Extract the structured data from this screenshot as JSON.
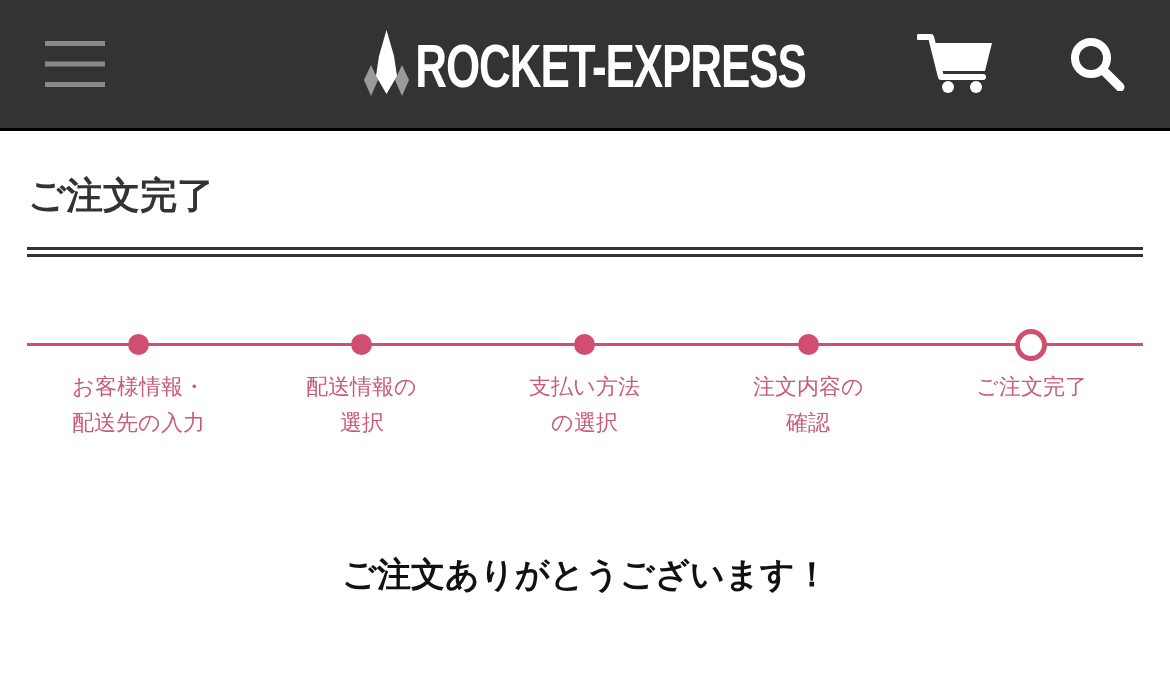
{
  "header": {
    "logo": "ROCKET-EXPRESS"
  },
  "page_title": "ご注文完了",
  "steps": [
    {
      "lines": [
        "お客様情報・",
        "配送先の入力"
      ],
      "current": false
    },
    {
      "lines": [
        "配送情報の",
        "選択"
      ],
      "current": false
    },
    {
      "lines": [
        "支払い方法",
        "の選択"
      ],
      "current": false
    },
    {
      "lines": [
        "注文内容の",
        "確認"
      ],
      "current": false
    },
    {
      "lines": [
        "ご注文完了"
      ],
      "current": true
    }
  ],
  "message": "ご注文ありがとうございます！"
}
